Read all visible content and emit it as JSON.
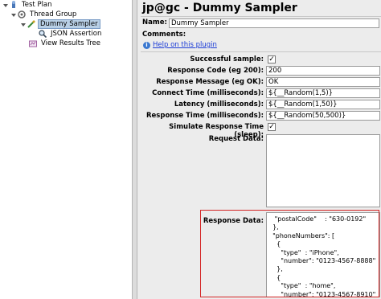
{
  "tree": {
    "items": [
      {
        "label": "Test Plan",
        "icon": "test-plan-icon"
      },
      {
        "label": "Thread Group",
        "icon": "thread-group-icon"
      },
      {
        "label": "Dummy Sampler",
        "icon": "dummy-sampler-icon",
        "selected": true
      },
      {
        "label": "JSON Assertion",
        "icon": "magnifier-icon"
      },
      {
        "label": "View Results Tree",
        "icon": "results-tree-icon"
      }
    ]
  },
  "panel": {
    "title": "jp@gc - Dummy Sampler",
    "name_label": "Name:",
    "name_value": "Dummy Sampler",
    "comments_label": "Comments:",
    "help_link": "Help on this plugin",
    "fields": {
      "successful_label": "Successful sample:",
      "successful_checked": true,
      "response_code_label": "Response Code (eg 200):",
      "response_code_value": "200",
      "response_message_label": "Response Message (eg OK):",
      "response_message_value": "OK",
      "connect_time_label": "Connect Time (milliseconds):",
      "connect_time_value": "${__Random(1,5)}",
      "latency_label": "Latency (milliseconds):",
      "latency_value": "${__Random(1,50)}",
      "response_time_label": "Response Time (milliseconds):",
      "response_time_value": "${__Random(50,500)}",
      "simulate_label": "Simulate Response Time (sleep):",
      "simulate_checked": true,
      "request_data_label": "Request Data:",
      "response_data_label": "Response Data:"
    },
    "response_lines": [
      "   \"postalCode\"    : \"630-0192\"",
      "  },",
      "  \"phoneNumbers\": [",
      "    {",
      "      \"type\"  : \"iPhone\",",
      "      \"number\": \"0123-4567-8888\"",
      "    },",
      "    {",
      "      \"type\"  : \"home\",",
      "      \"number\": \"0123-4567-8910\""
    ]
  },
  "colors": {
    "highlight": "#d42424",
    "selection": "#b8cfe5",
    "link": "#1a3bd6",
    "panel_bg": "#ececec"
  }
}
